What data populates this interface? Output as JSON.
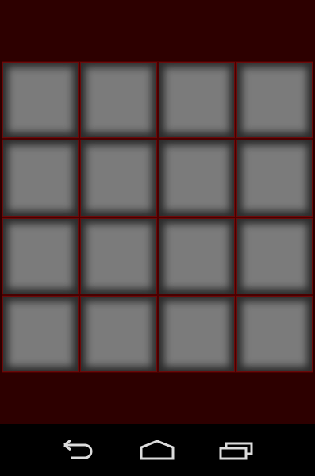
{
  "app": {
    "background_color": "#2d0000",
    "board_line_color": "#6a0a0a",
    "tile_color": "#7b7b7b"
  },
  "board": {
    "rows": 4,
    "cols": 4,
    "tiles": [
      {
        "state": "hidden"
      },
      {
        "state": "hidden"
      },
      {
        "state": "hidden"
      },
      {
        "state": "hidden"
      },
      {
        "state": "hidden"
      },
      {
        "state": "hidden"
      },
      {
        "state": "hidden"
      },
      {
        "state": "hidden"
      },
      {
        "state": "hidden"
      },
      {
        "state": "hidden"
      },
      {
        "state": "hidden"
      },
      {
        "state": "hidden"
      },
      {
        "state": "hidden"
      },
      {
        "state": "hidden"
      },
      {
        "state": "hidden"
      },
      {
        "state": "hidden"
      }
    ]
  },
  "nav_bar": {
    "buttons": [
      {
        "icon": "back-icon"
      },
      {
        "icon": "home-icon"
      },
      {
        "icon": "recent-apps-icon"
      }
    ],
    "icon_color": "#dcdcdc"
  }
}
